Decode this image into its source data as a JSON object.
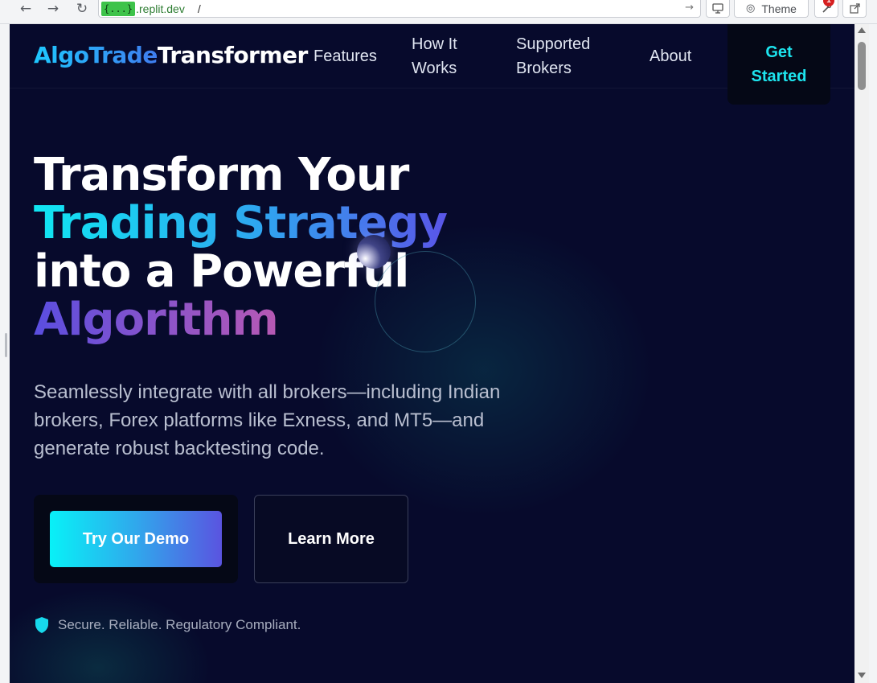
{
  "browser": {
    "back_icon": "arrow-left-icon",
    "forward_icon": "arrow-right-icon",
    "reload_icon": "reload-icon",
    "url_badge": "{...}",
    "url_host": ".replit.dev",
    "url_path": "/",
    "theme_label": "Theme",
    "notification_count": "1"
  },
  "header": {
    "logo_part1": "AlgoTrade",
    "logo_part2": "Transformer",
    "nav": {
      "features": "Features",
      "how_it_works_line1": "How It",
      "how_it_works_line2": "Works",
      "supported_brokers_line1": "Supported",
      "supported_brokers_line2": "Brokers",
      "about": "About"
    },
    "cta_line1": "Get",
    "cta_line2": "Started"
  },
  "hero": {
    "title_line1": "Transform Your",
    "title_line2": "Trading Strategy",
    "title_line3": "into a Powerful",
    "title_line4": "Algorithm",
    "subtitle": "Seamlessly integrate with all brokers—including Indian brokers, Forex platforms like Exness, and MT5—and generate robust backtesting code.",
    "primary_button": "Try Our Demo",
    "secondary_button": "Learn More",
    "trust_text": "Secure. Reliable. Regulatory Compliant."
  },
  "colors": {
    "background": "#070a2c",
    "accent_cyan": "#10e6f2",
    "accent_blue": "#3f7df0",
    "accent_purple": "#5a4ee0",
    "accent_pink": "#f26b7a"
  }
}
